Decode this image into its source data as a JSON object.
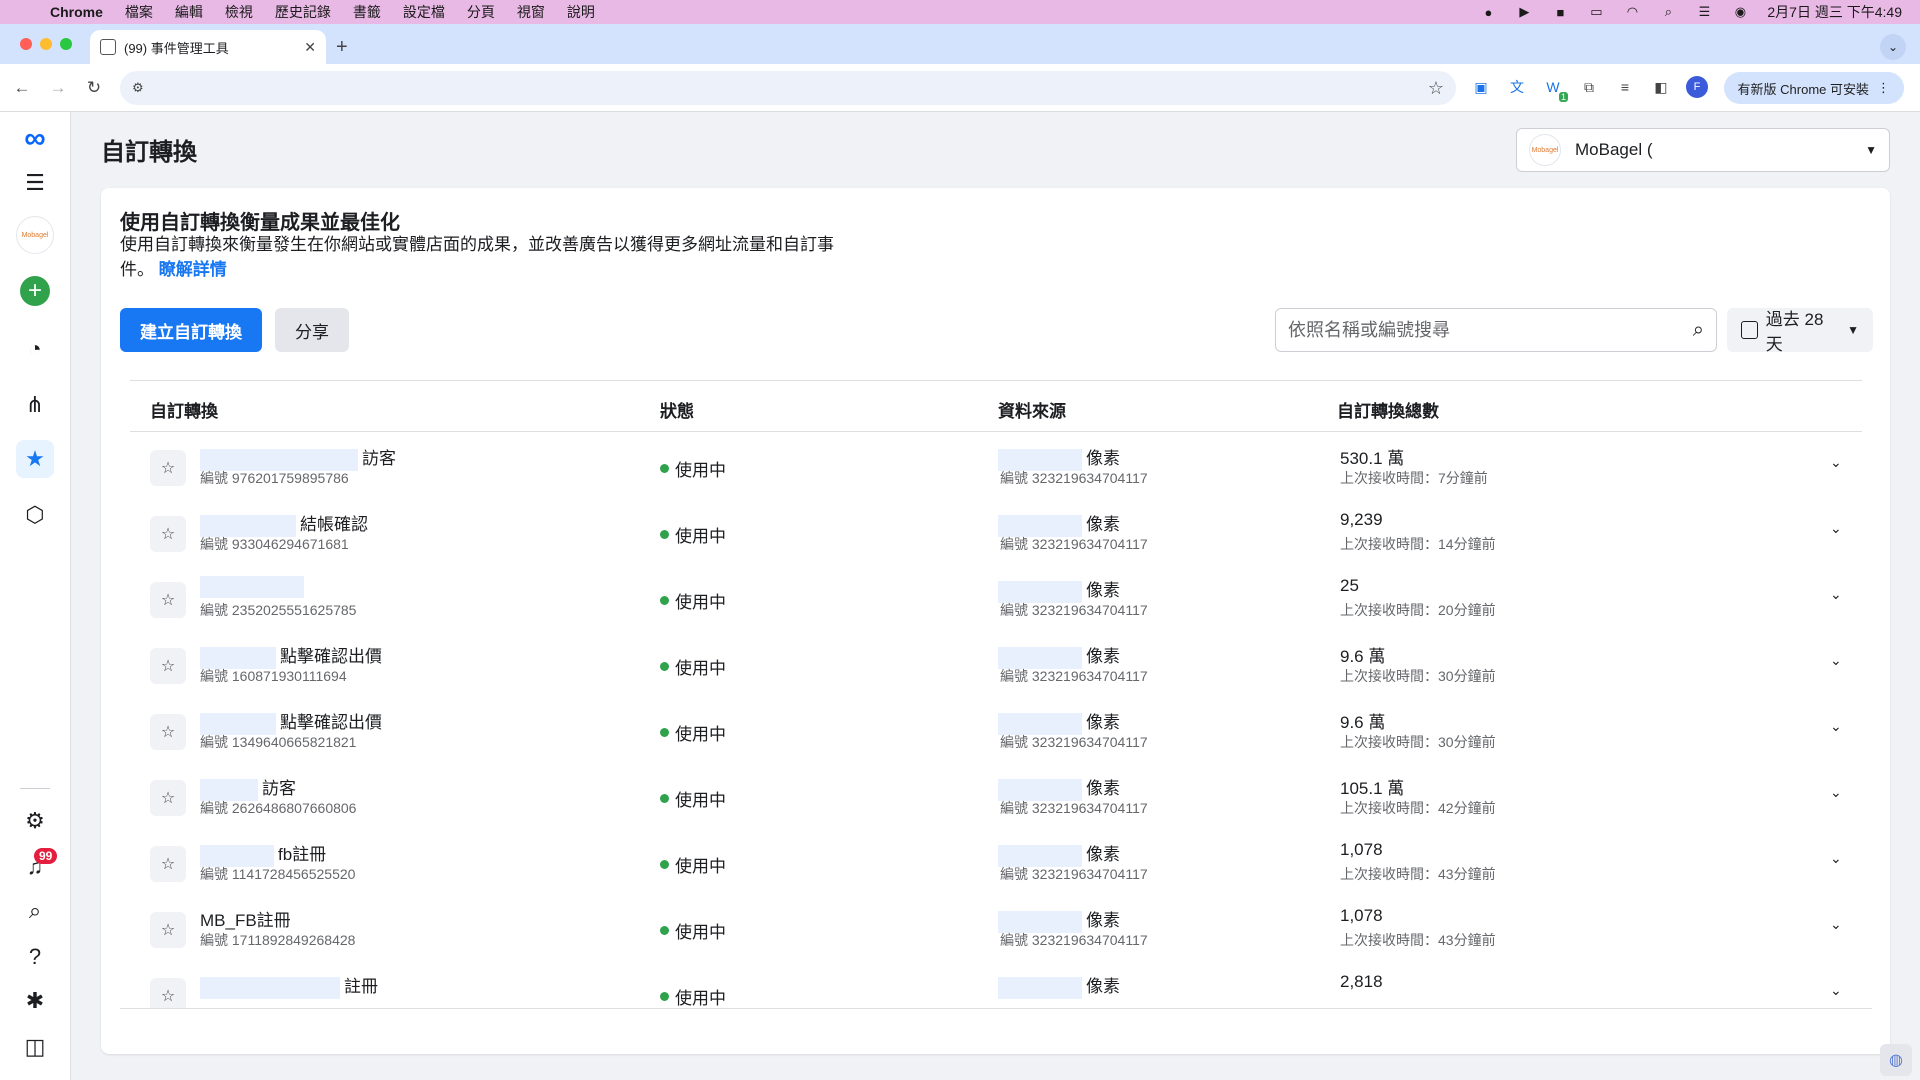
{
  "menubar": {
    "app": "Chrome",
    "items": [
      "檔案",
      "編輯",
      "檢視",
      "歷史記錄",
      "書籤",
      "設定檔",
      "分頁",
      "視窗",
      "說明"
    ],
    "clock": "2月7日 週三 下午4:49"
  },
  "browser": {
    "tab_title": "(99) 事件管理工具",
    "update_label": "有新版 Chrome 可安裝",
    "profile_initial": "F",
    "ext_badge": "1"
  },
  "rail": {
    "notification_count": "99",
    "account_logo_text": "Mobagel"
  },
  "header": {
    "title": "自訂轉換",
    "account_name": "MoBagel (",
    "account_logo_text": "Mobagel"
  },
  "card": {
    "heading": "使用自訂轉換衡量成果並最佳化",
    "description": "使用自訂轉換來衡量發生在你網站或實體店面的成果，並改善廣告以獲得更多網址流量和自訂事件。",
    "learn_more": "瞭解詳情",
    "create_button": "建立自訂轉換",
    "share_button": "分享",
    "search_placeholder": "依照名稱或編號搜尋",
    "date_range": "過去 28 天"
  },
  "table": {
    "columns": [
      "自訂轉換",
      "狀態",
      "資料來源",
      "自訂轉換總數"
    ],
    "rows": [
      {
        "name": "訪客",
        "id": "編號 976201759895786",
        "status": "使用中",
        "source": "像素",
        "source_id": "編號 323219634704117",
        "count": "530.1 萬",
        "received": "上次接收時間：7分鐘前"
      },
      {
        "name": "結帳確認",
        "id": "編號 933046294671681",
        "status": "使用中",
        "source": "像素",
        "source_id": "編號 323219634704117",
        "count": "9,239",
        "received": "上次接收時間：14分鐘前"
      },
      {
        "name": "",
        "id": "編號 2352025551625785",
        "status": "使用中",
        "source": "像素",
        "source_id": "編號 323219634704117",
        "count": "25",
        "received": "上次接收時間：20分鐘前"
      },
      {
        "name": "點擊確認出價",
        "id": "編號 160871930111694",
        "status": "使用中",
        "source": "像素",
        "source_id": "編號 323219634704117",
        "count": "9.6 萬",
        "received": "上次接收時間：30分鐘前"
      },
      {
        "name": "點擊確認出價",
        "id": "編號 1349640665821821",
        "status": "使用中",
        "source": "像素",
        "source_id": "編號 323219634704117",
        "count": "9.6 萬",
        "received": "上次接收時間：30分鐘前"
      },
      {
        "name": "訪客",
        "id": "編號 2626486807660806",
        "status": "使用中",
        "source": "像素",
        "source_id": "編號 323219634704117",
        "count": "105.1 萬",
        "received": "上次接收時間：42分鐘前"
      },
      {
        "name": "fb註冊",
        "id": "編號 1141728456525520",
        "status": "使用中",
        "source": "像素",
        "source_id": "編號 323219634704117",
        "count": "1,078",
        "received": "上次接收時間：43分鐘前"
      },
      {
        "name": "MB_FB註冊",
        "id": "編號 1711892849268428",
        "status": "使用中",
        "source": "像素",
        "source_id": "編號 323219634704117",
        "count": "1,078",
        "received": "上次接收時間：43分鐘前"
      },
      {
        "name": "註冊",
        "id": "",
        "status": "使用中",
        "source": "像素",
        "source_id": "",
        "count": "2,818",
        "received": ""
      }
    ]
  },
  "colors": {
    "primary": "#1877f2",
    "status_active": "#31a24c",
    "menubar": "#e9b9e6",
    "tabstrip": "#d3e3fd"
  }
}
